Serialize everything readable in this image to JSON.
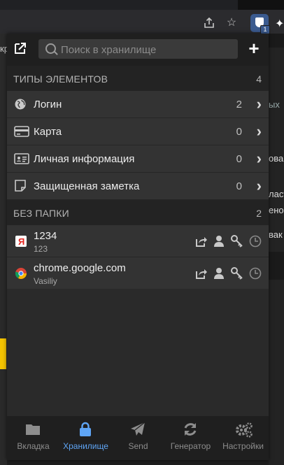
{
  "browser": {
    "page_fragments_left": [
      "кр"
    ],
    "page_fragments_right": [
      "ых",
      "ова",
      "ласт",
      "ено",
      "вак"
    ],
    "extension_badge": "1"
  },
  "header": {
    "search_placeholder": "Поиск в хранилище"
  },
  "types_section": {
    "title": "ТИПЫ ЭЛЕМЕНТОВ",
    "count": "4",
    "rows": [
      {
        "label": "Логин",
        "count": "2",
        "icon": "globe-icon"
      },
      {
        "label": "Карта",
        "count": "0",
        "icon": "credit-card-icon"
      },
      {
        "label": "Личная информация",
        "count": "0",
        "icon": "id-card-icon"
      },
      {
        "label": "Защищенная заметка",
        "count": "0",
        "icon": "note-icon"
      }
    ]
  },
  "folder_section": {
    "title": "БЕЗ ПАПКИ",
    "count": "2",
    "items": [
      {
        "name": "1234",
        "username": "123",
        "favicon": "yandex-icon"
      },
      {
        "name": "chrome.google.com",
        "username": "Vasiliy",
        "favicon": "chrome-icon"
      }
    ]
  },
  "tabs": [
    {
      "label": "Вкладка",
      "icon": "folder-icon",
      "active": false
    },
    {
      "label": "Хранилище",
      "icon": "lock-icon",
      "active": true
    },
    {
      "label": "Send",
      "icon": "paper-plane-icon",
      "active": false
    },
    {
      "label": "Генератор",
      "icon": "refresh-icon",
      "active": false
    },
    {
      "label": "Настройки",
      "icon": "cogs-icon",
      "active": false
    }
  ],
  "colors": {
    "accent": "#5fa5f5",
    "background": "#2e2e2e",
    "header": "#1f1f1f"
  }
}
